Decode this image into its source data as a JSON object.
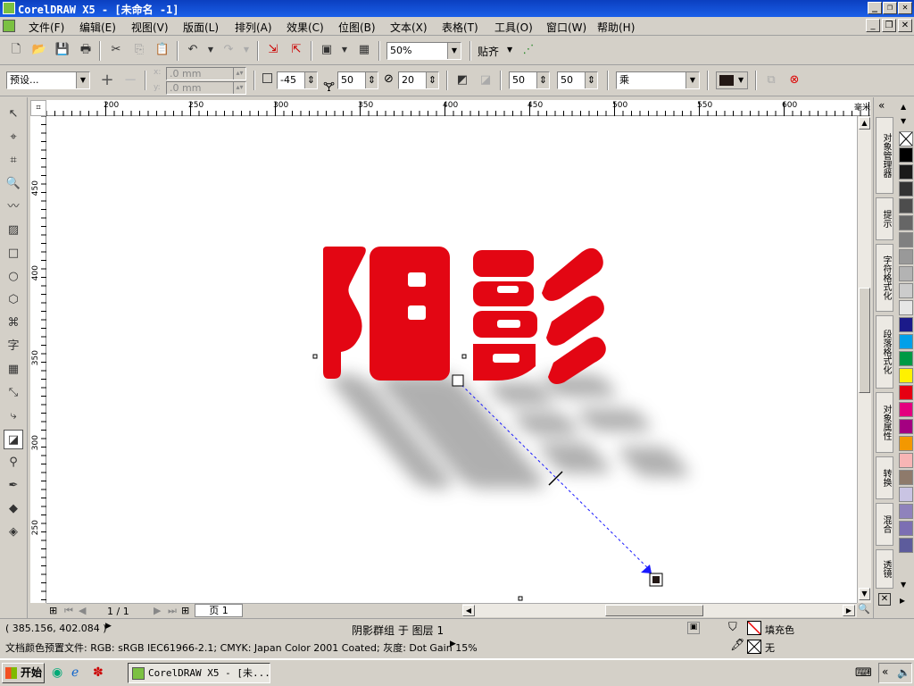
{
  "window": {
    "title": "CorelDRAW X5 - [未命名 -1]"
  },
  "menu": [
    "文件(F)",
    "编辑(E)",
    "视图(V)",
    "版面(L)",
    "排列(A)",
    "效果(C)",
    "位图(B)",
    "文本(X)",
    "表格(T)",
    "工具(O)",
    "窗口(W)",
    "帮助(H)"
  ],
  "toolbar": {
    "zoom": "50%",
    "snap_label": "贴齐"
  },
  "property_bar": {
    "preset": "预设...",
    "x_offset": ".0 mm",
    "y_offset": ".0 mm",
    "shadow_angle": "-45",
    "stretch": "50",
    "opacity": "20",
    "feather": "50",
    "fade": "50",
    "blend_mode": "乘"
  },
  "rulers": {
    "top": [
      "200",
      "250",
      "300",
      "350",
      "400",
      "450",
      "500",
      "550",
      "600"
    ],
    "left": [
      "450",
      "400",
      "350",
      "300",
      "250"
    ],
    "unit": "毫米"
  },
  "canvas": {
    "text": "阴影",
    "text_color": "#e30613",
    "shadow_color": "#808080"
  },
  "page_nav": {
    "count": "1 / 1",
    "tab": "页 1"
  },
  "dockers": [
    "对象管理器",
    "提示",
    "字符格式化",
    "段落格式化",
    "对象属性",
    "转换",
    "混合",
    "透镜"
  ],
  "palette": [
    "#ffffff",
    "#000000",
    "#1a1a1a",
    "#333333",
    "#4d4d4d",
    "#666666",
    "#808080",
    "#999999",
    "#b3b3b3",
    "#cccccc",
    "#e6e6e6",
    "#1b1a8a",
    "#00a0e9",
    "#009944",
    "#fff100",
    "#e60012",
    "#e4007f",
    "#a40081",
    "#f39800",
    "#f7b5b5",
    "#8e7a6b",
    "#c9c4e3",
    "#8f82bc",
    "#7c6fb3",
    "#5d5c9c"
  ],
  "status": {
    "coords": "( 385.156, 402.084 )",
    "selection": "阴影群组 于 图层 1",
    "fill_label": "填充色",
    "outline_label": "无",
    "profile": "文档颜色预置文件: RGB: sRGB IEC61966-2.1; CMYK: Japan Color 2001 Coated; 灰度: Dot Gain 15%"
  },
  "taskbar": {
    "start": "开始",
    "task": "CorelDRAW X5 - [未..."
  }
}
